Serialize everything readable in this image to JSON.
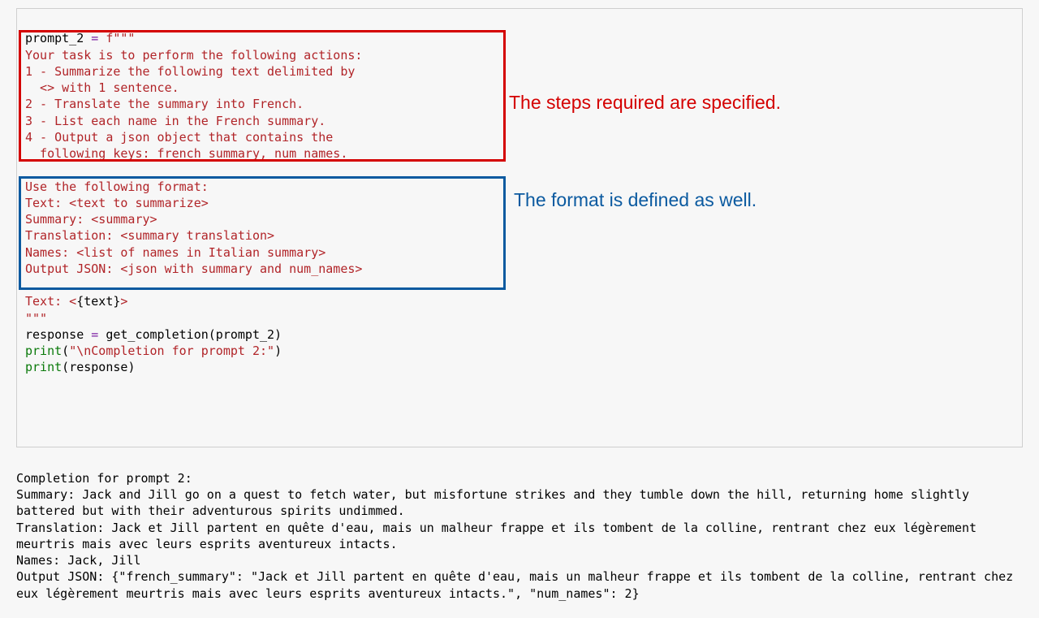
{
  "code": {
    "assign_lhs": "prompt_2",
    "assign_op": " = ",
    "fstr_open": "f\"\"\"",
    "block1_l1": "Your task is to perform the following actions: ",
    "block1_l2": "1 - Summarize the following text delimited by ",
    "block1_l3": "  <> with 1 sentence.",
    "block1_l4": "2 - Translate the summary into French.",
    "block1_l5": "3 - List each name in the French summary.",
    "block1_l6": "4 - Output a json object that contains the ",
    "block1_l7": "  following keys: french_summary, num_names.",
    "block2_l1": "Use the following format:",
    "block2_l2": "Text: <text to summarize>",
    "block2_l3": "Summary: <summary>",
    "block2_l4": "Translation: <summary translation>",
    "block2_l5": "Names: <list of names in Italian summary>",
    "block2_l6": "Output JSON: <json with summary and num_names>",
    "text_prefix": "Text: <",
    "text_interp": "{text}",
    "text_suffix": ">",
    "fstr_close": "\"\"\"",
    "resp_lhs": "response",
    "resp_op": " = ",
    "resp_call": "get_completion(prompt_2)",
    "print1_fn": "print",
    "print1_open": "(",
    "print1_arg": "\"\\nCompletion for prompt 2:\"",
    "print1_close": ")",
    "print2_fn": "print",
    "print2_open": "(",
    "print2_arg": "response",
    "print2_close": ")"
  },
  "annotations": {
    "steps": "The steps required are specified.",
    "format": "The format is defined as well."
  },
  "output": {
    "blank": "",
    "l0": "Completion for prompt 2:",
    "l1": "Summary: Jack and Jill go on a quest to fetch water, but misfortune strikes and they tumble down the hill, returning home slightly battered but with their adventurous spirits undimmed.",
    "l2": "Translation: Jack et Jill partent en quête d'eau, mais un malheur frappe et ils tombent de la colline, rentrant chez eux légèrement meurtris mais avec leurs esprits aventureux intacts.",
    "l3": "Names: Jack, Jill",
    "l4": "Output JSON: {\"french_summary\": \"Jack et Jill partent en quête d'eau, mais un malheur frappe et ils tombent de la colline, rentrant chez eux légèrement meurtris mais avec leurs esprits aventureux intacts.\", \"num_names\": 2}"
  }
}
